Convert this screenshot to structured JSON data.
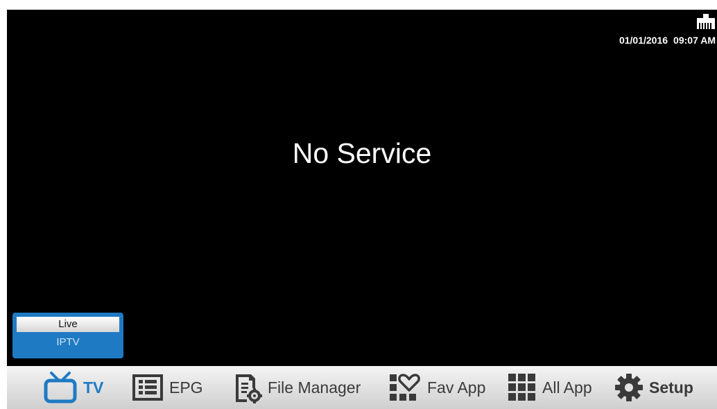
{
  "status_bar": {
    "date": "01/01/2016",
    "time": "09:07 AM",
    "network_icon": "ethernet-icon"
  },
  "main": {
    "message": "No Service"
  },
  "source_menu": {
    "items": [
      {
        "label": "Live",
        "selected": true
      },
      {
        "label": "IPTV",
        "selected": false
      }
    ]
  },
  "navbar": {
    "items": [
      {
        "label": "TV",
        "icon": "tv-icon",
        "active": true
      },
      {
        "label": "EPG",
        "icon": "epg-icon",
        "active": false
      },
      {
        "label": "File Manager",
        "icon": "file-manager-icon",
        "active": false
      },
      {
        "label": "Fav App",
        "icon": "fav-app-icon",
        "active": false
      },
      {
        "label": "All App",
        "icon": "all-app-icon",
        "active": false
      },
      {
        "label": "Setup",
        "icon": "gear-icon",
        "active": false
      }
    ]
  },
  "colors": {
    "accent": "#1f7ac4",
    "screen_background": "#000000",
    "nav_text": "#3a3a3a"
  }
}
